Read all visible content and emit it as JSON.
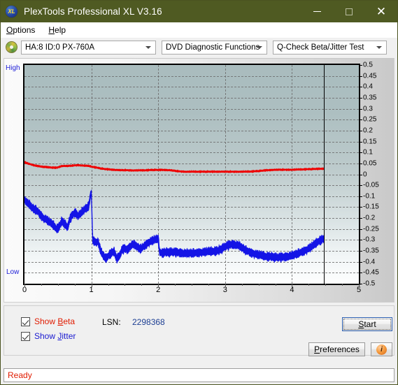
{
  "window": {
    "title": "PlexTools Professional XL V3.16",
    "app_icon": "XL",
    "minimize_label": "minimize",
    "maximize_label": "maximize",
    "close_label": "✕",
    "titlebar_color": "#4f5a22"
  },
  "menu": {
    "items": [
      {
        "label": "Options",
        "accel": "O"
      },
      {
        "label": "Help",
        "accel": "H"
      }
    ]
  },
  "toolbar": {
    "drive_select": "HA:8 ID:0  PX-760A",
    "function_select": "DVD Diagnostic Functions",
    "test_select": "Q-Check Beta/Jitter Test"
  },
  "controls": {
    "show_beta_label": "Show Beta",
    "show_beta_checked": true,
    "show_jitter_label": "Show Jitter",
    "show_jitter_checked": true,
    "lsn_label": "LSN:",
    "lsn_value": "2298368",
    "start_label": "Start",
    "preferences_label": "Preferences",
    "info_label": "i"
  },
  "status": {
    "text": "Ready"
  },
  "chart_data": {
    "type": "line",
    "title": "Q-Check Beta/Jitter Test",
    "xlabel": "",
    "ylabel": "",
    "xlim": [
      0,
      5
    ],
    "ylim": [
      -0.5,
      0.5
    ],
    "xticks": [
      0,
      1,
      2,
      3,
      4,
      5
    ],
    "yticks": [
      0.5,
      0.45,
      0.4,
      0.35,
      0.3,
      0.25,
      0.2,
      0.15,
      0.1,
      0.05,
      0,
      -0.05,
      -0.1,
      -0.15,
      -0.2,
      -0.25,
      -0.3,
      -0.35,
      -0.4,
      -0.45,
      -0.5
    ],
    "ytick_labels": [
      "0.5",
      "0.45",
      "0.4",
      "0.35",
      "0.3",
      "0.25",
      "0.2",
      "0.15",
      "0.1",
      "0.05",
      "0",
      "-0.05",
      "-0.1",
      "-0.15",
      "-0.2",
      "-0.25",
      "-0.3",
      "-0.35",
      "-0.4",
      "-0.45",
      "-0.5"
    ],
    "axis_high_label": "High",
    "axis_low_label": "Low",
    "grid": true,
    "grid_style": "dashed",
    "cursor_x": 4.48,
    "data_end_x": 4.48,
    "legend": [
      "Show Beta",
      "Show Jitter"
    ],
    "colors": {
      "beta": "#ee0000",
      "jitter": "#1414e6",
      "grid": "#6e6e6e",
      "axis": "#000000"
    },
    "series": [
      {
        "name": "Beta",
        "color": "#ee0000",
        "x": [
          0.0,
          0.08,
          0.16,
          0.24,
          0.32,
          0.4,
          0.48,
          0.56,
          0.64,
          0.72,
          0.8,
          0.88,
          0.96,
          1.04,
          1.12,
          1.2,
          1.28,
          1.36,
          1.44,
          1.52,
          1.6,
          1.68,
          1.76,
          1.84,
          1.92,
          2.0,
          2.1,
          2.2,
          2.3,
          2.4,
          2.5,
          2.6,
          2.7,
          2.8,
          2.9,
          3.0,
          3.1,
          3.2,
          3.3,
          3.4,
          3.5,
          3.6,
          3.7,
          3.8,
          3.9,
          4.0,
          4.1,
          4.2,
          4.3,
          4.4,
          4.48
        ],
        "values": [
          0.055,
          0.047,
          0.04,
          0.036,
          0.033,
          0.031,
          0.03,
          0.038,
          0.038,
          0.04,
          0.042,
          0.04,
          0.038,
          0.033,
          0.028,
          0.024,
          0.022,
          0.02,
          0.019,
          0.019,
          0.018,
          0.018,
          0.018,
          0.019,
          0.02,
          0.02,
          0.02,
          0.018,
          0.014,
          0.012,
          0.012,
          0.012,
          0.012,
          0.012,
          0.012,
          0.012,
          0.012,
          0.012,
          0.012,
          0.013,
          0.015,
          0.018,
          0.02,
          0.021,
          0.021,
          0.021,
          0.022,
          0.023,
          0.024,
          0.025,
          0.026
        ],
        "band": 0.006
      },
      {
        "name": "Jitter",
        "color": "#1414e6",
        "x": [
          0.0,
          0.04,
          0.08,
          0.12,
          0.16,
          0.2,
          0.24,
          0.28,
          0.32,
          0.36,
          0.4,
          0.44,
          0.48,
          0.52,
          0.56,
          0.6,
          0.64,
          0.68,
          0.72,
          0.76,
          0.8,
          0.84,
          0.88,
          0.92,
          0.96,
          0.99,
          1.0,
          1.02,
          1.06,
          1.1,
          1.14,
          1.18,
          1.22,
          1.26,
          1.3,
          1.34,
          1.38,
          1.42,
          1.46,
          1.5,
          1.54,
          1.58,
          1.62,
          1.66,
          1.7,
          1.74,
          1.78,
          1.82,
          1.86,
          1.9,
          1.94,
          1.98,
          2.0,
          2.02,
          2.06,
          2.1,
          2.2,
          2.3,
          2.4,
          2.5,
          2.6,
          2.7,
          2.8,
          2.9,
          3.0,
          3.1,
          3.2,
          3.3,
          3.4,
          3.5,
          3.6,
          3.7,
          3.8,
          3.9,
          4.0,
          4.1,
          4.2,
          4.3,
          4.4,
          4.48
        ],
        "values": [
          -0.115,
          -0.13,
          -0.14,
          -0.155,
          -0.16,
          -0.17,
          -0.185,
          -0.2,
          -0.205,
          -0.215,
          -0.225,
          -0.235,
          -0.25,
          -0.24,
          -0.215,
          -0.225,
          -0.245,
          -0.205,
          -0.185,
          -0.175,
          -0.19,
          -0.18,
          -0.165,
          -0.155,
          -0.145,
          -0.09,
          -0.085,
          -0.3,
          -0.31,
          -0.308,
          -0.35,
          -0.375,
          -0.385,
          -0.37,
          -0.36,
          -0.355,
          -0.385,
          -0.375,
          -0.345,
          -0.34,
          -0.345,
          -0.33,
          -0.32,
          -0.325,
          -0.335,
          -0.34,
          -0.33,
          -0.32,
          -0.31,
          -0.305,
          -0.3,
          -0.298,
          -0.295,
          -0.355,
          -0.36,
          -0.358,
          -0.355,
          -0.358,
          -0.362,
          -0.36,
          -0.358,
          -0.355,
          -0.352,
          -0.35,
          -0.33,
          -0.32,
          -0.325,
          -0.345,
          -0.36,
          -0.368,
          -0.375,
          -0.378,
          -0.38,
          -0.378,
          -0.372,
          -0.36,
          -0.348,
          -0.33,
          -0.305,
          -0.295
        ],
        "band": 0.03
      }
    ]
  }
}
